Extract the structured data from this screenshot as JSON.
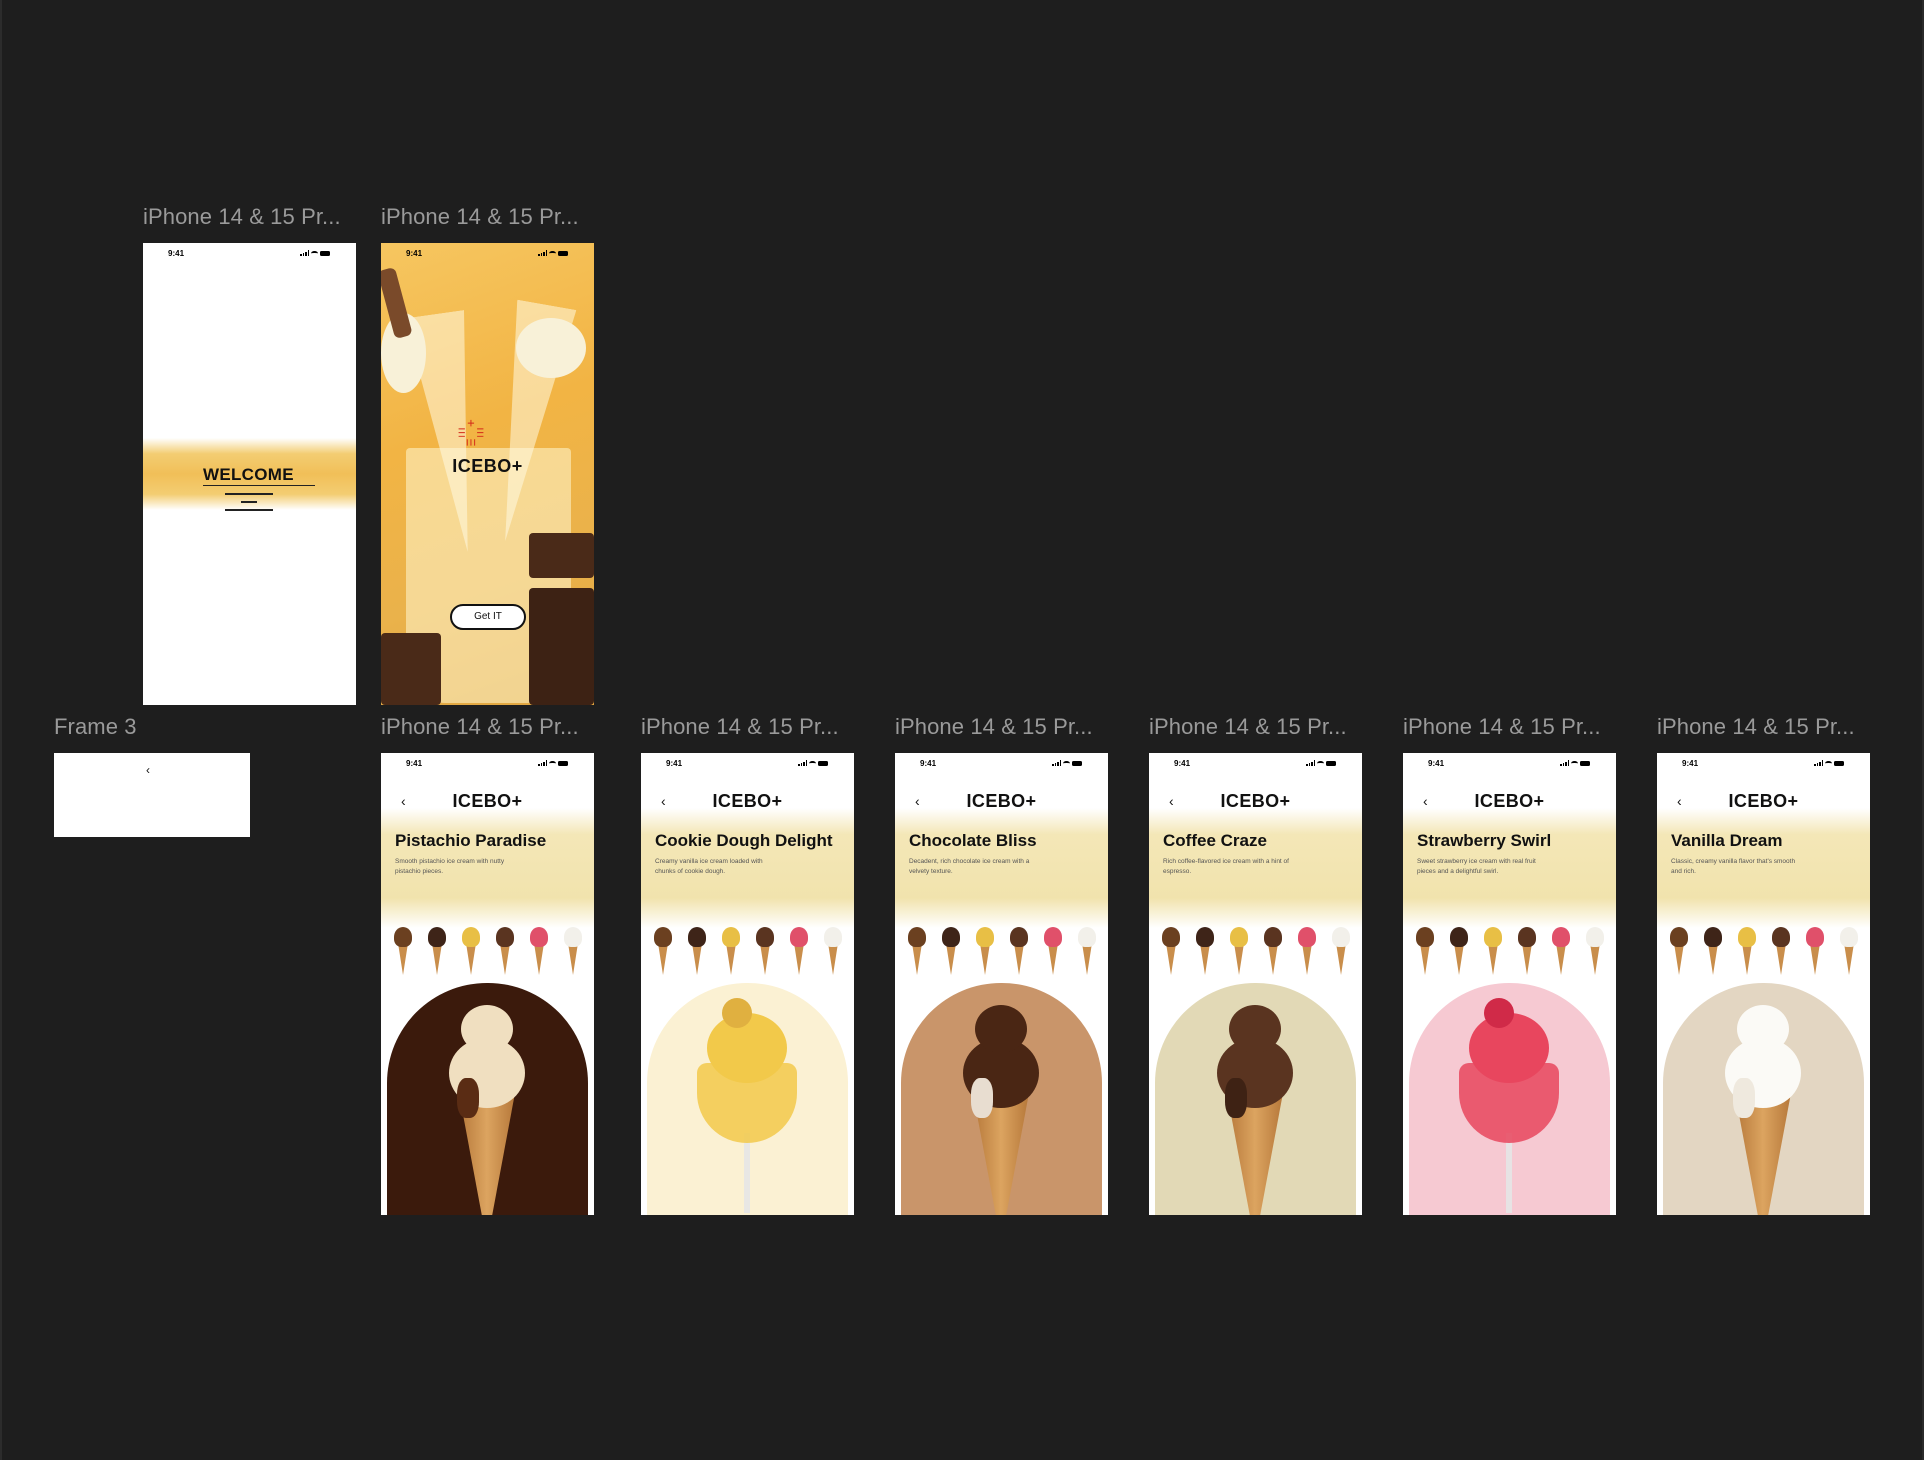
{
  "canvas": {
    "background": "#1e1e1e",
    "label_color": "#9a9a9a"
  },
  "frames": {
    "welcome": {
      "label": "iPhone 14 & 15 Pr...",
      "time": "9:41",
      "text": "WELCOME"
    },
    "splash": {
      "label": "iPhone 14 & 15 Pr...",
      "time": "9:41",
      "logo_mark": "꙲",
      "logo": "ICEBO+",
      "button": "Get IT"
    },
    "frame3": {
      "label": "Frame 3",
      "chevron": "‹"
    },
    "details": [
      {
        "label": "iPhone 14 & 15 Pr...",
        "time": "9:41",
        "back": "‹",
        "logo": "ICEBO+",
        "title": "Pistachio Paradise",
        "desc": "Smooth pistachio ice cream with nutty pistachio pieces.",
        "arch_color": "#3b1a0c",
        "scoop_color": "#f0dfc0",
        "accent_color": "#5a2c14"
      },
      {
        "label": "iPhone 14 & 15 Pr...",
        "time": "9:41",
        "back": "‹",
        "logo": "ICEBO+",
        "title": "Cookie Dough Delight",
        "desc": "Creamy vanilla ice cream loaded with chunks of cookie dough.",
        "arch_color": "#fbf1d3",
        "scoop_color": "#f2c94a",
        "accent_color": "#e0b040"
      },
      {
        "label": "iPhone 14 & 15 Pr...",
        "time": "9:41",
        "back": "‹",
        "logo": "ICEBO+",
        "title": "Chocolate Bliss",
        "desc": "Decadent, rich chocolate ice cream with a velvety texture.",
        "arch_color": "#c9956a",
        "scoop_color": "#4a2614",
        "accent_color": "#e8ddd0"
      },
      {
        "label": "iPhone 14 & 15 Pr...",
        "time": "9:41",
        "back": "‹",
        "logo": "ICEBO+",
        "title": "Coffee Craze",
        "desc": "Rich coffee-flavored ice cream with a hint of espresso.",
        "arch_color": "#e2d9b6",
        "scoop_color": "#5a3420",
        "accent_color": "#3e2214"
      },
      {
        "label": "iPhone 14 & 15 Pr...",
        "time": "9:41",
        "back": "‹",
        "logo": "ICEBO+",
        "title": "Strawberry Swirl",
        "desc": "Sweet strawberry ice cream with real fruit pieces and a delightful swirl.",
        "arch_color": "#f6c9d2",
        "scoop_color": "#e8465e",
        "accent_color": "#d02a48"
      },
      {
        "label": "iPhone 14 & 15 Pr...",
        "time": "9:41",
        "back": "‹",
        "logo": "ICEBO+",
        "title": "Vanilla Dream",
        "desc": "Classic, creamy vanilla flavor that's smooth and rich.",
        "arch_color": "#e3d6c2",
        "scoop_color": "#fbfaf6",
        "accent_color": "#efe9de"
      }
    ],
    "thumb_colors": [
      "#6b4020",
      "#3e2418",
      "#e8bf45",
      "#5a3420",
      "#e0506a",
      "#f2f0ea"
    ]
  }
}
